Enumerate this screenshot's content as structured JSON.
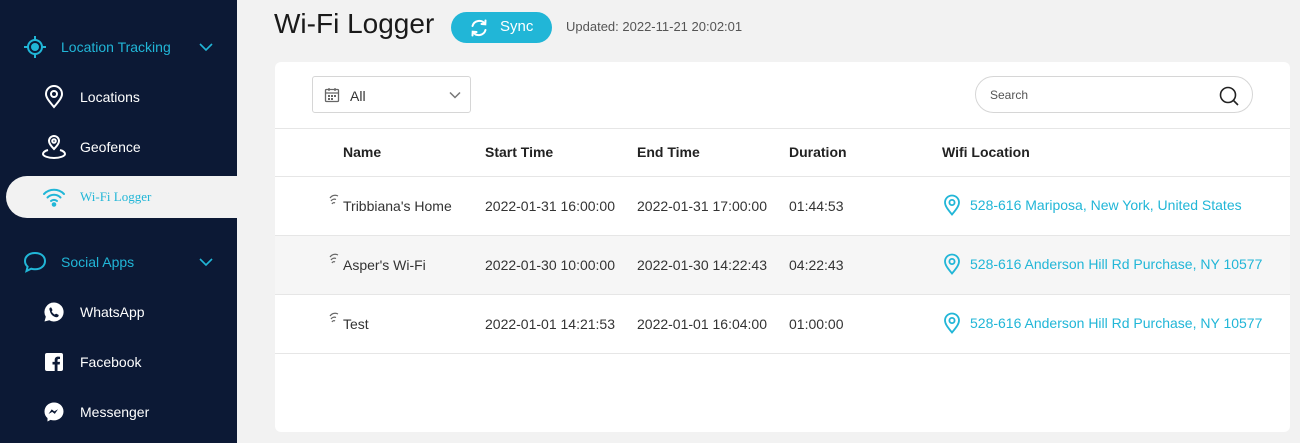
{
  "sidebar": {
    "items": [
      {
        "label": "Location Tracking",
        "icon": "crosshair-icon",
        "type": "section"
      },
      {
        "label": "Locations",
        "icon": "map-pin-icon"
      },
      {
        "label": "Geofence",
        "icon": "geofence-icon"
      },
      {
        "label": "Wi-Fi Logger",
        "icon": "wifi-icon",
        "active": true
      },
      {
        "label": "Social Apps",
        "icon": "chat-bubble-icon",
        "type": "section"
      },
      {
        "label": "WhatsApp",
        "icon": "whatsapp-icon"
      },
      {
        "label": "Facebook",
        "icon": "facebook-icon"
      },
      {
        "label": "Messenger",
        "icon": "messenger-icon"
      }
    ]
  },
  "header": {
    "title": "Wi-Fi Logger",
    "sync_label": "Sync",
    "updated": "Updated: 2022-11-21 20:02:01"
  },
  "filter": {
    "value": "All"
  },
  "search": {
    "placeholder": "Search"
  },
  "table": {
    "columns": [
      "Name",
      "Start Time",
      "End Time",
      "Duration",
      "Wifi Location"
    ],
    "rows": [
      {
        "name": "Tribbiana's Home",
        "start": "2022-01-31 16:00:00",
        "end": "2022-01-31 17:00:00",
        "duration": "01:44:53",
        "location": "528-616 Mariposa, New York, United States"
      },
      {
        "name": "Asper's Wi-Fi",
        "start": "2022-01-30 10:00:00",
        "end": "2022-01-30 14:22:43",
        "duration": "04:22:43",
        "location": "528-616 Anderson Hill Rd Purchase, NY 10577"
      },
      {
        "name": "Test",
        "start": "2022-01-01 14:21:53",
        "end": "2022-01-01 16:04:00",
        "duration": "01:00:00",
        "location": "528-616 Anderson Hill Rd Purchase, NY 10577"
      }
    ]
  },
  "colors": {
    "accent": "#21b6d7",
    "sidebar_bg": "#0c1935",
    "page_bg": "#f2f2f2"
  }
}
